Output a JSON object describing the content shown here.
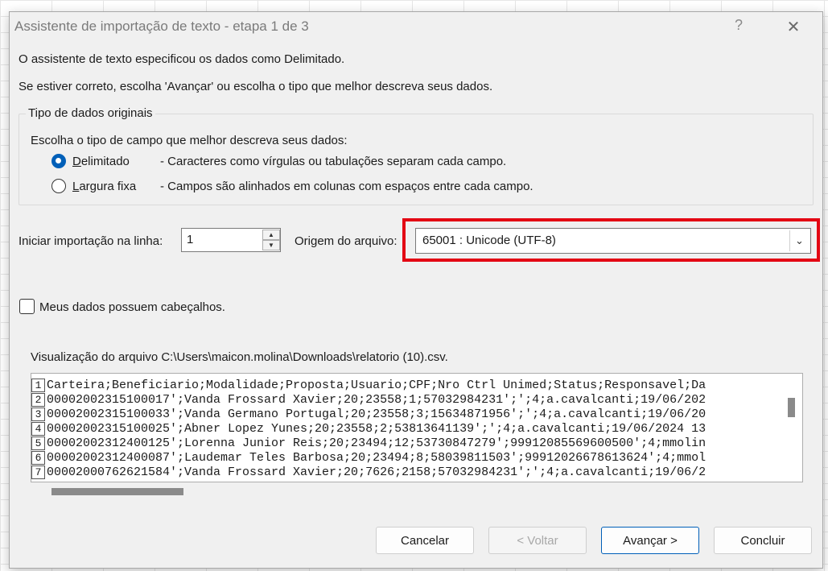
{
  "dialog": {
    "title": "Assistente de importação de texto - etapa 1 de 3",
    "help_label": "?",
    "close_label": "✕"
  },
  "intro": {
    "line1": "O assistente de texto especificou os dados como Delimitado.",
    "line2": "Se estiver correto, escolha 'Avançar' ou escolha o tipo que melhor descreva seus dados."
  },
  "data_type_group": {
    "legend": "Tipo de dados originais",
    "prompt": "Escolha o tipo de campo que melhor descreva seus dados:",
    "options": [
      {
        "label": "Delimitado",
        "description": "- Caracteres como vírgulas ou tabulações separam cada campo.",
        "selected": true
      },
      {
        "label": "Largura fixa",
        "description": "- Campos são alinhados em colunas com espaços entre cada campo.",
        "selected": false
      }
    ]
  },
  "start_row": {
    "label": "Iniciar importação na linha:",
    "value": "1"
  },
  "file_origin": {
    "label": "Origem do arquivo:",
    "value": "65001 : Unicode (UTF-8)"
  },
  "headers_checkbox": {
    "label": "Meus dados possuem cabeçalhos.",
    "checked": false
  },
  "preview": {
    "label": "Visualização do arquivo C:\\Users\\maicon.molina\\Downloads\\relatorio (10).csv.",
    "rows": [
      {
        "num": "1",
        "text": "Carteira;Beneficiario;Modalidade;Proposta;Usuario;CPF;Nro Ctrl Unimed;Status;Responsavel;Da"
      },
      {
        "num": "2",
        "text": "00002002315100017';Vanda Frossard Xavier;20;23558;1;57032984231';';4;a.cavalcanti;19/06/202"
      },
      {
        "num": "3",
        "text": "00002002315100033';Vanda Germano Portugal;20;23558;3;15634871956';';4;a.cavalcanti;19/06/20"
      },
      {
        "num": "4",
        "text": "00002002315100025';Abner Lopez Yunes;20;23558;2;53813641139';';4;a.cavalcanti;19/06/2024 13"
      },
      {
        "num": "5",
        "text": "00002002312400125';Lorenna Junior Reis;20;23494;12;53730847279';99912085569600500';4;mmolin"
      },
      {
        "num": "6",
        "text": "00002002312400087';Laudemar Teles Barbosa;20;23494;8;58039811503';99912026678613624';4;mmol"
      },
      {
        "num": "7",
        "text": "00002000762621584';Vanda Frossard Xavier;20;7626;2158;57032984231';';4;a.cavalcanti;19/06/2"
      }
    ]
  },
  "buttons": {
    "cancel": "Cancelar",
    "back": "< Voltar",
    "next": "Avançar >",
    "finish": "Concluir"
  },
  "colors": {
    "accent": "#005fb8",
    "highlight": "#e30613",
    "dialog_bg": "#f0f0f0"
  }
}
